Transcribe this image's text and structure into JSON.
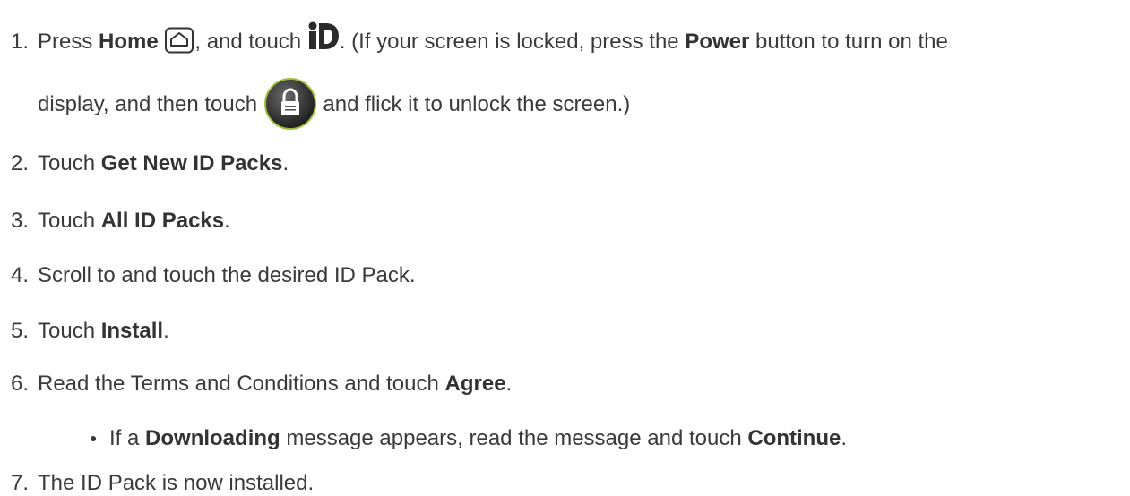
{
  "steps": [
    {
      "num": "1.",
      "t1": "Press ",
      "b1": "Home",
      "t2": ", and touch ",
      "t3": ". (If your screen is locked, press the ",
      "b2": "Power",
      "t4": " button to turn on the",
      "t5": "display, and then touch ",
      "t6": " and flick it to unlock the screen.)",
      "icons": [
        "home-icon",
        "id-app-icon",
        "lock-icon"
      ]
    },
    {
      "num": "2.",
      "t1": "Touch ",
      "b1": "Get New ID Packs",
      "t2": "."
    },
    {
      "num": "3.",
      "t1": "Touch ",
      "b1": "All ID Packs",
      "t2": "."
    },
    {
      "num": "4.",
      "t1": "Scroll to and touch the desired ID Pack."
    },
    {
      "num": "5.",
      "t1": "Touch ",
      "b1": "Install",
      "t2": "."
    },
    {
      "num": "6.",
      "t1": "Read the Terms and Conditions and touch ",
      "b1": "Agree",
      "t2": "."
    },
    {
      "num": "7.",
      "t1": "The ID Pack is now installed."
    }
  ],
  "bullet": {
    "t1": "If a ",
    "b1": "Downloading",
    "t2": " message appears, read the message and touch ",
    "b2": "Continue",
    "t3": "."
  }
}
